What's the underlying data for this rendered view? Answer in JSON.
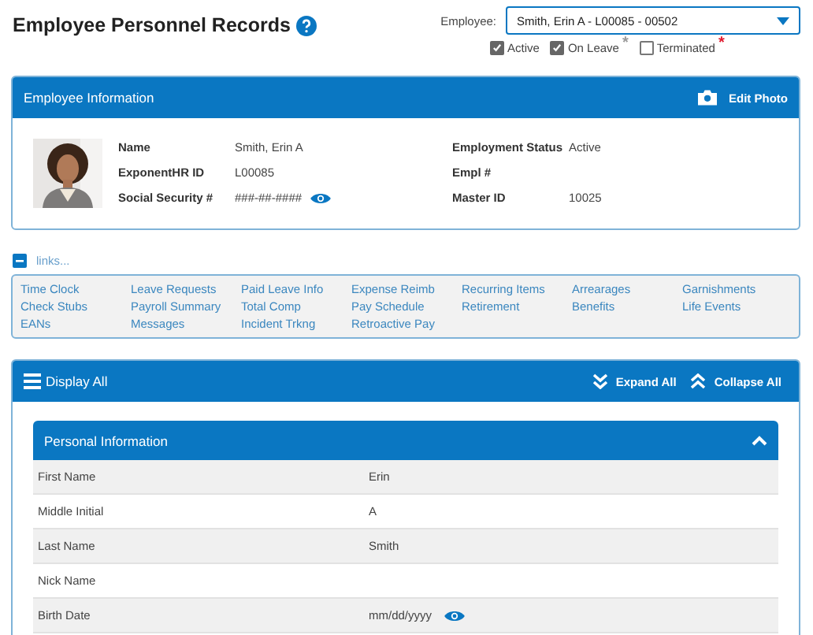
{
  "page": {
    "title": "Employee Personnel Records"
  },
  "employee_picker": {
    "label": "Employee:",
    "value": "Smith, Erin A - L00085 - 00502"
  },
  "filters": [
    {
      "label": "Active",
      "checked": true
    },
    {
      "label": "On Leave",
      "checked": true,
      "marker": {
        "text": "*",
        "color": "#999999"
      }
    },
    {
      "label": "Terminated",
      "checked": false,
      "marker": {
        "text": "*",
        "color": "#e0182d"
      }
    }
  ],
  "employee_info": {
    "title": "Employee Information",
    "edit_button": "Edit Photo",
    "left": [
      {
        "label": "Name",
        "value": "Smith, Erin A"
      },
      {
        "label": "ExponentHR ID",
        "value": "L00085"
      },
      {
        "label": "Social Security #",
        "value": "###-##-####",
        "revealable": true
      }
    ],
    "right": [
      {
        "label": "Employment Status",
        "value": "Active"
      },
      {
        "label": "Empl #"
      },
      {
        "label": "Master ID",
        "value": "10025"
      }
    ]
  },
  "links": {
    "toggle": "links...",
    "expanded": true,
    "columns": [
      [
        "Time Clock",
        "Check Stubs",
        "EANs"
      ],
      [
        "Leave Requests",
        "Payroll Summary",
        "Messages"
      ],
      [
        "Paid Leave Info",
        "Total Comp",
        "Incident Trkng"
      ],
      [
        "Expense Reimb",
        "Pay Schedule",
        "Retroactive Pay"
      ],
      [
        "Recurring Items",
        "Retirement"
      ],
      [
        "Arrearages",
        "Benefits"
      ],
      [
        "Garnishments",
        "Life Events"
      ]
    ]
  },
  "display": {
    "title": "Display All",
    "expand_all": "Expand All",
    "collapse_all": "Collapse All"
  },
  "personal_info": {
    "title": "Personal Information",
    "expanded": true,
    "rows": [
      {
        "label": "First Name",
        "value": "Erin"
      },
      {
        "label": "Middle Initial",
        "value": "A"
      },
      {
        "label": "Last Name",
        "value": "Smith"
      },
      {
        "label": "Nick Name"
      },
      {
        "label": "Birth Date",
        "value": "mm/dd/yyyy",
        "revealable": true
      }
    ]
  }
}
